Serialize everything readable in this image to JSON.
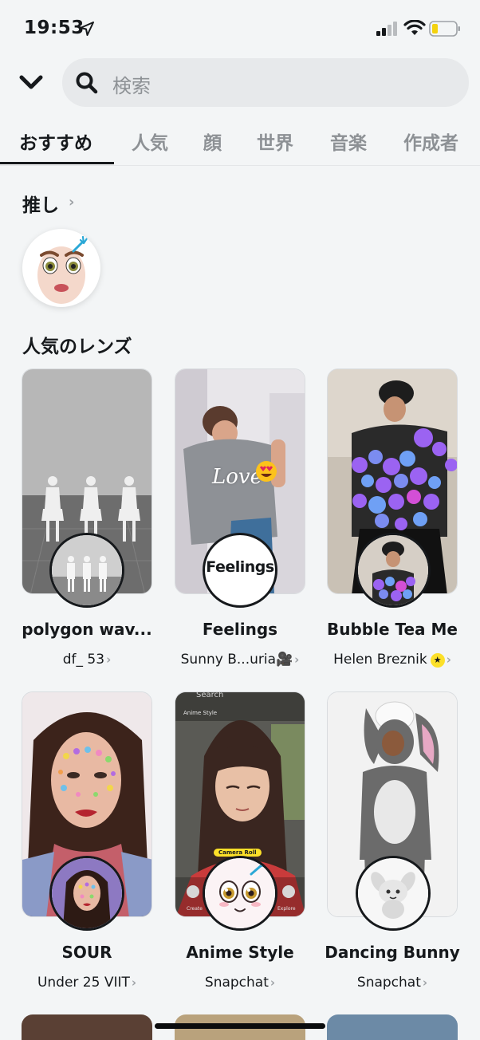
{
  "status_bar": {
    "time": "19:53"
  },
  "search": {
    "placeholder": "検索"
  },
  "tabs": [
    {
      "label": "おすすめ",
      "active": true
    },
    {
      "label": "人気"
    },
    {
      "label": "顔"
    },
    {
      "label": "世界"
    },
    {
      "label": "音楽"
    },
    {
      "label": "作成者"
    }
  ],
  "favorites": {
    "title": "推し",
    "chevron": "›"
  },
  "popular": {
    "title": "人気のレンズ",
    "lenses": [
      {
        "name": "polygon wav...",
        "creator": "df_ 53",
        "chevron": "›"
      },
      {
        "name": "Feelings",
        "creator": "Sunny B...uria🎥",
        "chevron": "›",
        "badge_text": "Feelings",
        "overlay_text": "Love"
      },
      {
        "name": "Bubble Tea Me",
        "creator": "Helen Breznik",
        "chevron": "›",
        "star": "★"
      },
      {
        "name": "SOUR",
        "creator": "Under 25 VIIT",
        "chevron": "›"
      },
      {
        "name": "Anime Style",
        "creator": "Snapchat",
        "chevron": "›",
        "camera_roll_label": "Camera Roll",
        "anime_style_label": "Anime Style",
        "search_label": "Search",
        "create_label": "Create",
        "explore_label": "Explore"
      },
      {
        "name": "Dancing Bunny",
        "creator": "Snapchat",
        "chevron": "›"
      }
    ]
  },
  "colors": {
    "background": "#f3f5f6",
    "search_bg": "#e7e9eb",
    "inactive_tab": "#8d9195",
    "verified_star": "#fce029",
    "text_primary": "#16191c"
  }
}
